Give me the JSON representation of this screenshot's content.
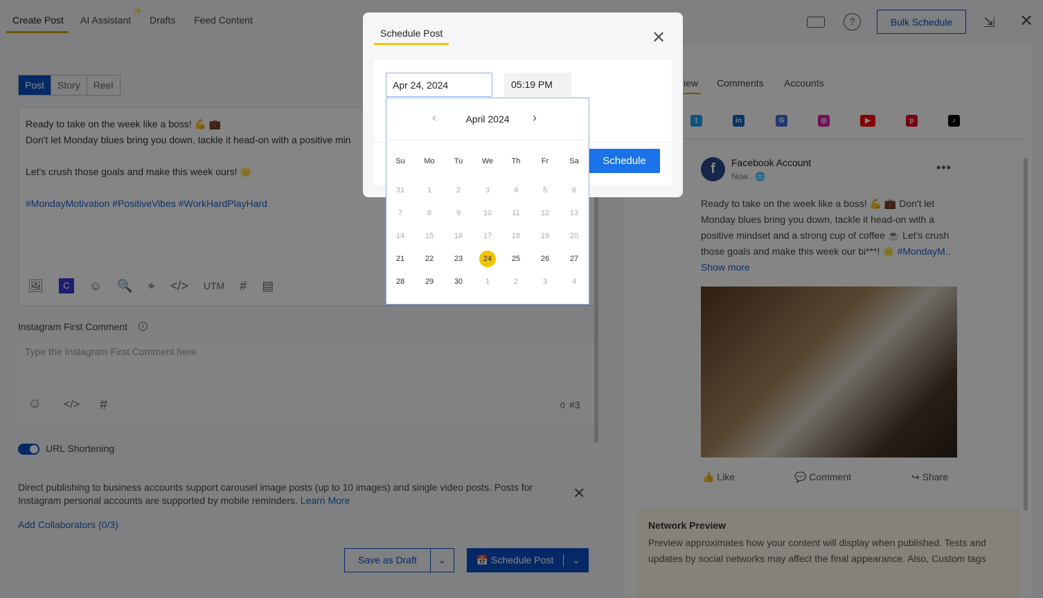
{
  "tabs": [
    {
      "label": "Create Post"
    },
    {
      "label": "AI Assistant"
    },
    {
      "label": "Drafts"
    },
    {
      "label": "Feed Content"
    }
  ],
  "header": {
    "bulk_schedule": "Bulk Schedule"
  },
  "post_types": [
    "Post",
    "Story",
    "Reel"
  ],
  "editor": {
    "line1": "Ready to take on the week like a boss! 💪 💼",
    "line2": "Don't let Monday blues bring you down, tackle it head-on with a positive min",
    "line3": "Let's crush those goals and make this week ours! 🌟",
    "hashtags": "#MondayMotivation #PositiveVibes #WorkHardPlayHard",
    "utm": "UTM"
  },
  "first_comment": {
    "label": "Instagram First Comment",
    "placeholder": "Type the Instagram First Comment here",
    "count": "0",
    "hash_count": "#3"
  },
  "url_shortening": {
    "label": "URL Shortening",
    "enabled": true
  },
  "notice": {
    "text": "Direct publishing to business accounts support carousel image posts (up to 10 images) and single video posts. Posts for Instagram personal accounts are supported by mobile reminders.",
    "link": "Learn More"
  },
  "collaborators": "Add Collaborators (0/3)",
  "footer": {
    "save_draft": "Save as Draft",
    "schedule_post": "Schedule Post"
  },
  "preview": {
    "tabs": [
      "iew",
      "Comments",
      "Accounts"
    ],
    "account": "Facebook Account",
    "time": "Now .",
    "text": "Ready to take on the week like a boss! 💪 💼 Don't let Monday blues bring you down, tackle it head-on with a positive mindset and a strong cup of coffee ☕ Let's crush those goals and make this week our bi***! 🌟",
    "hashtag": "#MondayM..",
    "show_more": "Show more",
    "like": "Like",
    "comment": "Comment",
    "share": "Share",
    "network_title": "Network Preview",
    "network_text": "Preview approximates how your content will display when published. Tests and updates by social networks may affect the final appearance. Also, Custom tags"
  },
  "modal": {
    "title": "Schedule Post",
    "date": "Apr 24, 2024",
    "time": "05:19 PM",
    "schedule": "Schedule",
    "month": "April 2024",
    "weekdays": [
      "Su",
      "Mo",
      "Tu",
      "We",
      "Th",
      "Fr",
      "Sa"
    ],
    "weeks": [
      [
        31,
        1,
        2,
        3,
        4,
        5,
        6
      ],
      [
        7,
        8,
        9,
        10,
        11,
        12,
        13
      ],
      [
        14,
        15,
        16,
        17,
        18,
        19,
        20
      ],
      [
        21,
        22,
        23,
        24,
        25,
        26,
        27
      ],
      [
        28,
        29,
        30,
        1,
        2,
        3,
        4
      ]
    ],
    "selected": 24
  },
  "colors": {
    "accent": "#f5c400",
    "primary": "#0a4fc4",
    "schedule": "#1a73e8"
  }
}
